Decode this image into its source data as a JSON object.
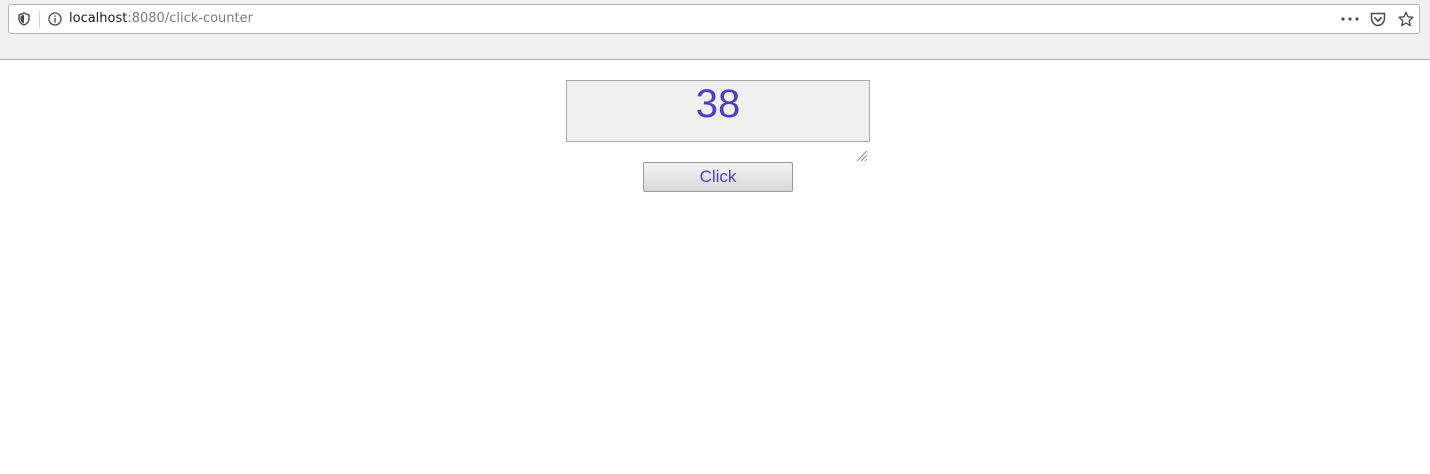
{
  "browser": {
    "url_host": "localhost",
    "url_rest": ":8080/click-counter",
    "icons": [
      "shield-icon",
      "info-icon",
      "more-icon",
      "pocket-icon",
      "star-icon"
    ]
  },
  "counter": {
    "value": "38",
    "color": "#4b3fc8"
  },
  "button": {
    "label": "Click"
  }
}
